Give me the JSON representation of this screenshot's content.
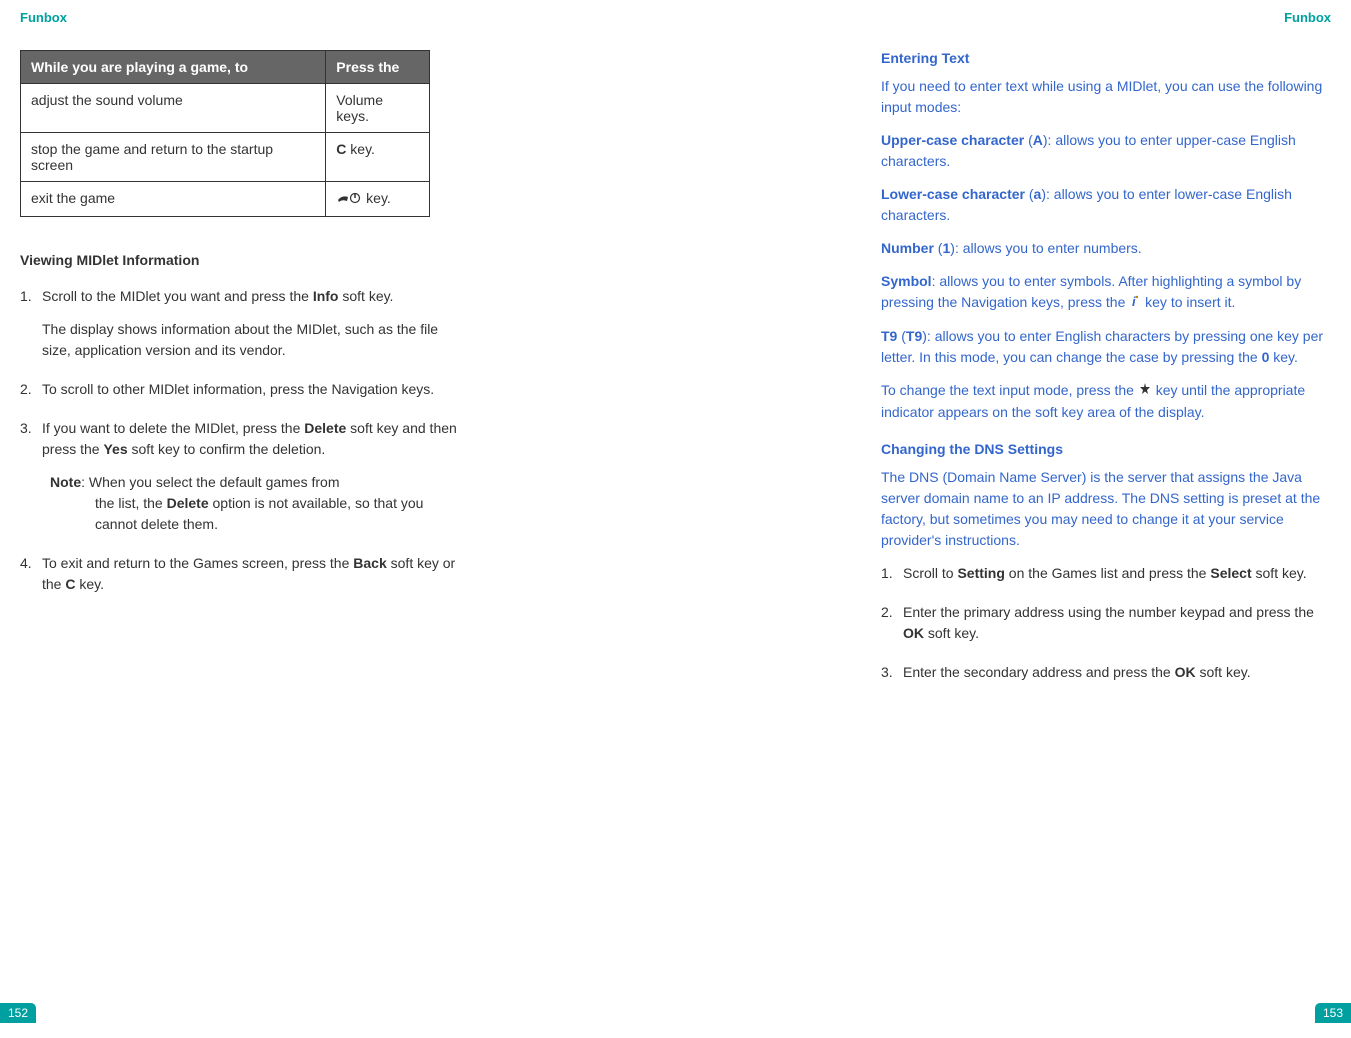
{
  "leftPage": {
    "header": "Funbox",
    "pageNumber": "152",
    "table": {
      "headers": {
        "col1": "While you are playing a game, to",
        "col2": "Press the"
      },
      "rows": [
        {
          "col1": "adjust the sound volume",
          "col2": "Volume keys."
        },
        {
          "col1": "stop the game and return to the startup screen",
          "col2_prefix": "",
          "col2_bold": "C",
          "col2_suffix": " key."
        },
        {
          "col1": "exit the game",
          "col2_icon": "phone-power-icon",
          "col2_suffix": " key."
        }
      ]
    },
    "sectionTitle": "Viewing MIDlet Information",
    "steps": [
      {
        "prefix": "Scroll to the MIDlet you want and press the ",
        "bold1": "Info",
        "suffix1": " soft key.",
        "subPara": "The display shows information about the MIDlet, such as the file size, application version and its vendor."
      },
      {
        "text": "To scroll to other MIDlet information, press the Navigation keys."
      },
      {
        "prefix": "If you want to delete the MIDlet, press the ",
        "bold1": "Delete",
        "mid1": " soft key and then press the ",
        "bold2": "Yes",
        "suffix1": " soft key to confirm the deletion.",
        "note": {
          "label": "Note",
          "line1": ": When you select the default games from",
          "line2": "the list, the ",
          "bold": "Delete",
          "line3": " option is not available, so that you cannot delete them."
        }
      },
      {
        "prefix": "To exit and return to the Games screen, press the ",
        "bold1": "Back",
        "mid1": " soft key or the ",
        "bold2": "C",
        "suffix1": " key."
      }
    ]
  },
  "rightPage": {
    "header": "Funbox",
    "pageNumber": "153",
    "section1Title": "Entering Text",
    "intro": "If you need to enter text while using a MIDlet, you can use the following input modes:",
    "modes": [
      {
        "label": "Upper-case character",
        "paren": " (",
        "boldParen": "A",
        "parenClose": ")",
        "desc": ": allows you to enter upper-case English characters."
      },
      {
        "label": "Lower-case character",
        "paren": " (",
        "boldParen": "a",
        "parenClose": ")",
        "desc": ": allows you to enter lower-case English characters."
      },
      {
        "label": "Number",
        "paren": " (",
        "boldParen": "1",
        "parenClose": ")",
        "desc": ": allows you to enter numbers."
      },
      {
        "label": "Symbol",
        "desc": ": allows you to enter symbols. After highlighting a symbol by pressing the Navigation keys, press the ",
        "icon": "i-icon",
        "descEnd": " key to insert it."
      },
      {
        "label": "T9",
        "paren": " (",
        "boldParen": "T9",
        "parenClose": ")",
        "desc": ": allows you to enter English characters by pressing one key per letter. In this mode, you can change the case by pressing the ",
        "boldInDesc": "0",
        "descEnd": " key."
      }
    ],
    "changeMode": {
      "prefix": "To change the text input mode, press the ",
      "icon": "star-icon",
      "suffix": " key until the appropriate indicator appears on the soft key area of the display."
    },
    "section2Title": "Changing the DNS Settings",
    "dnsIntro": "The DNS (Domain Name Server) is the server that assigns the Java server domain name to an IP address. The DNS setting is preset at the factory, but sometimes you may need to change it at your service provider's instructions.",
    "dnsSteps": [
      {
        "prefix": "Scroll to ",
        "bold1": "Setting",
        "mid1": " on the Games list and press the ",
        "bold2": "Select",
        "suffix": " soft key."
      },
      {
        "prefix": "Enter the primary address using the number keypad and press the ",
        "bold1": "OK",
        "suffix": " soft key."
      },
      {
        "prefix": "Enter the secondary address and press the ",
        "bold1": "OK",
        "suffix": " soft key."
      }
    ]
  }
}
